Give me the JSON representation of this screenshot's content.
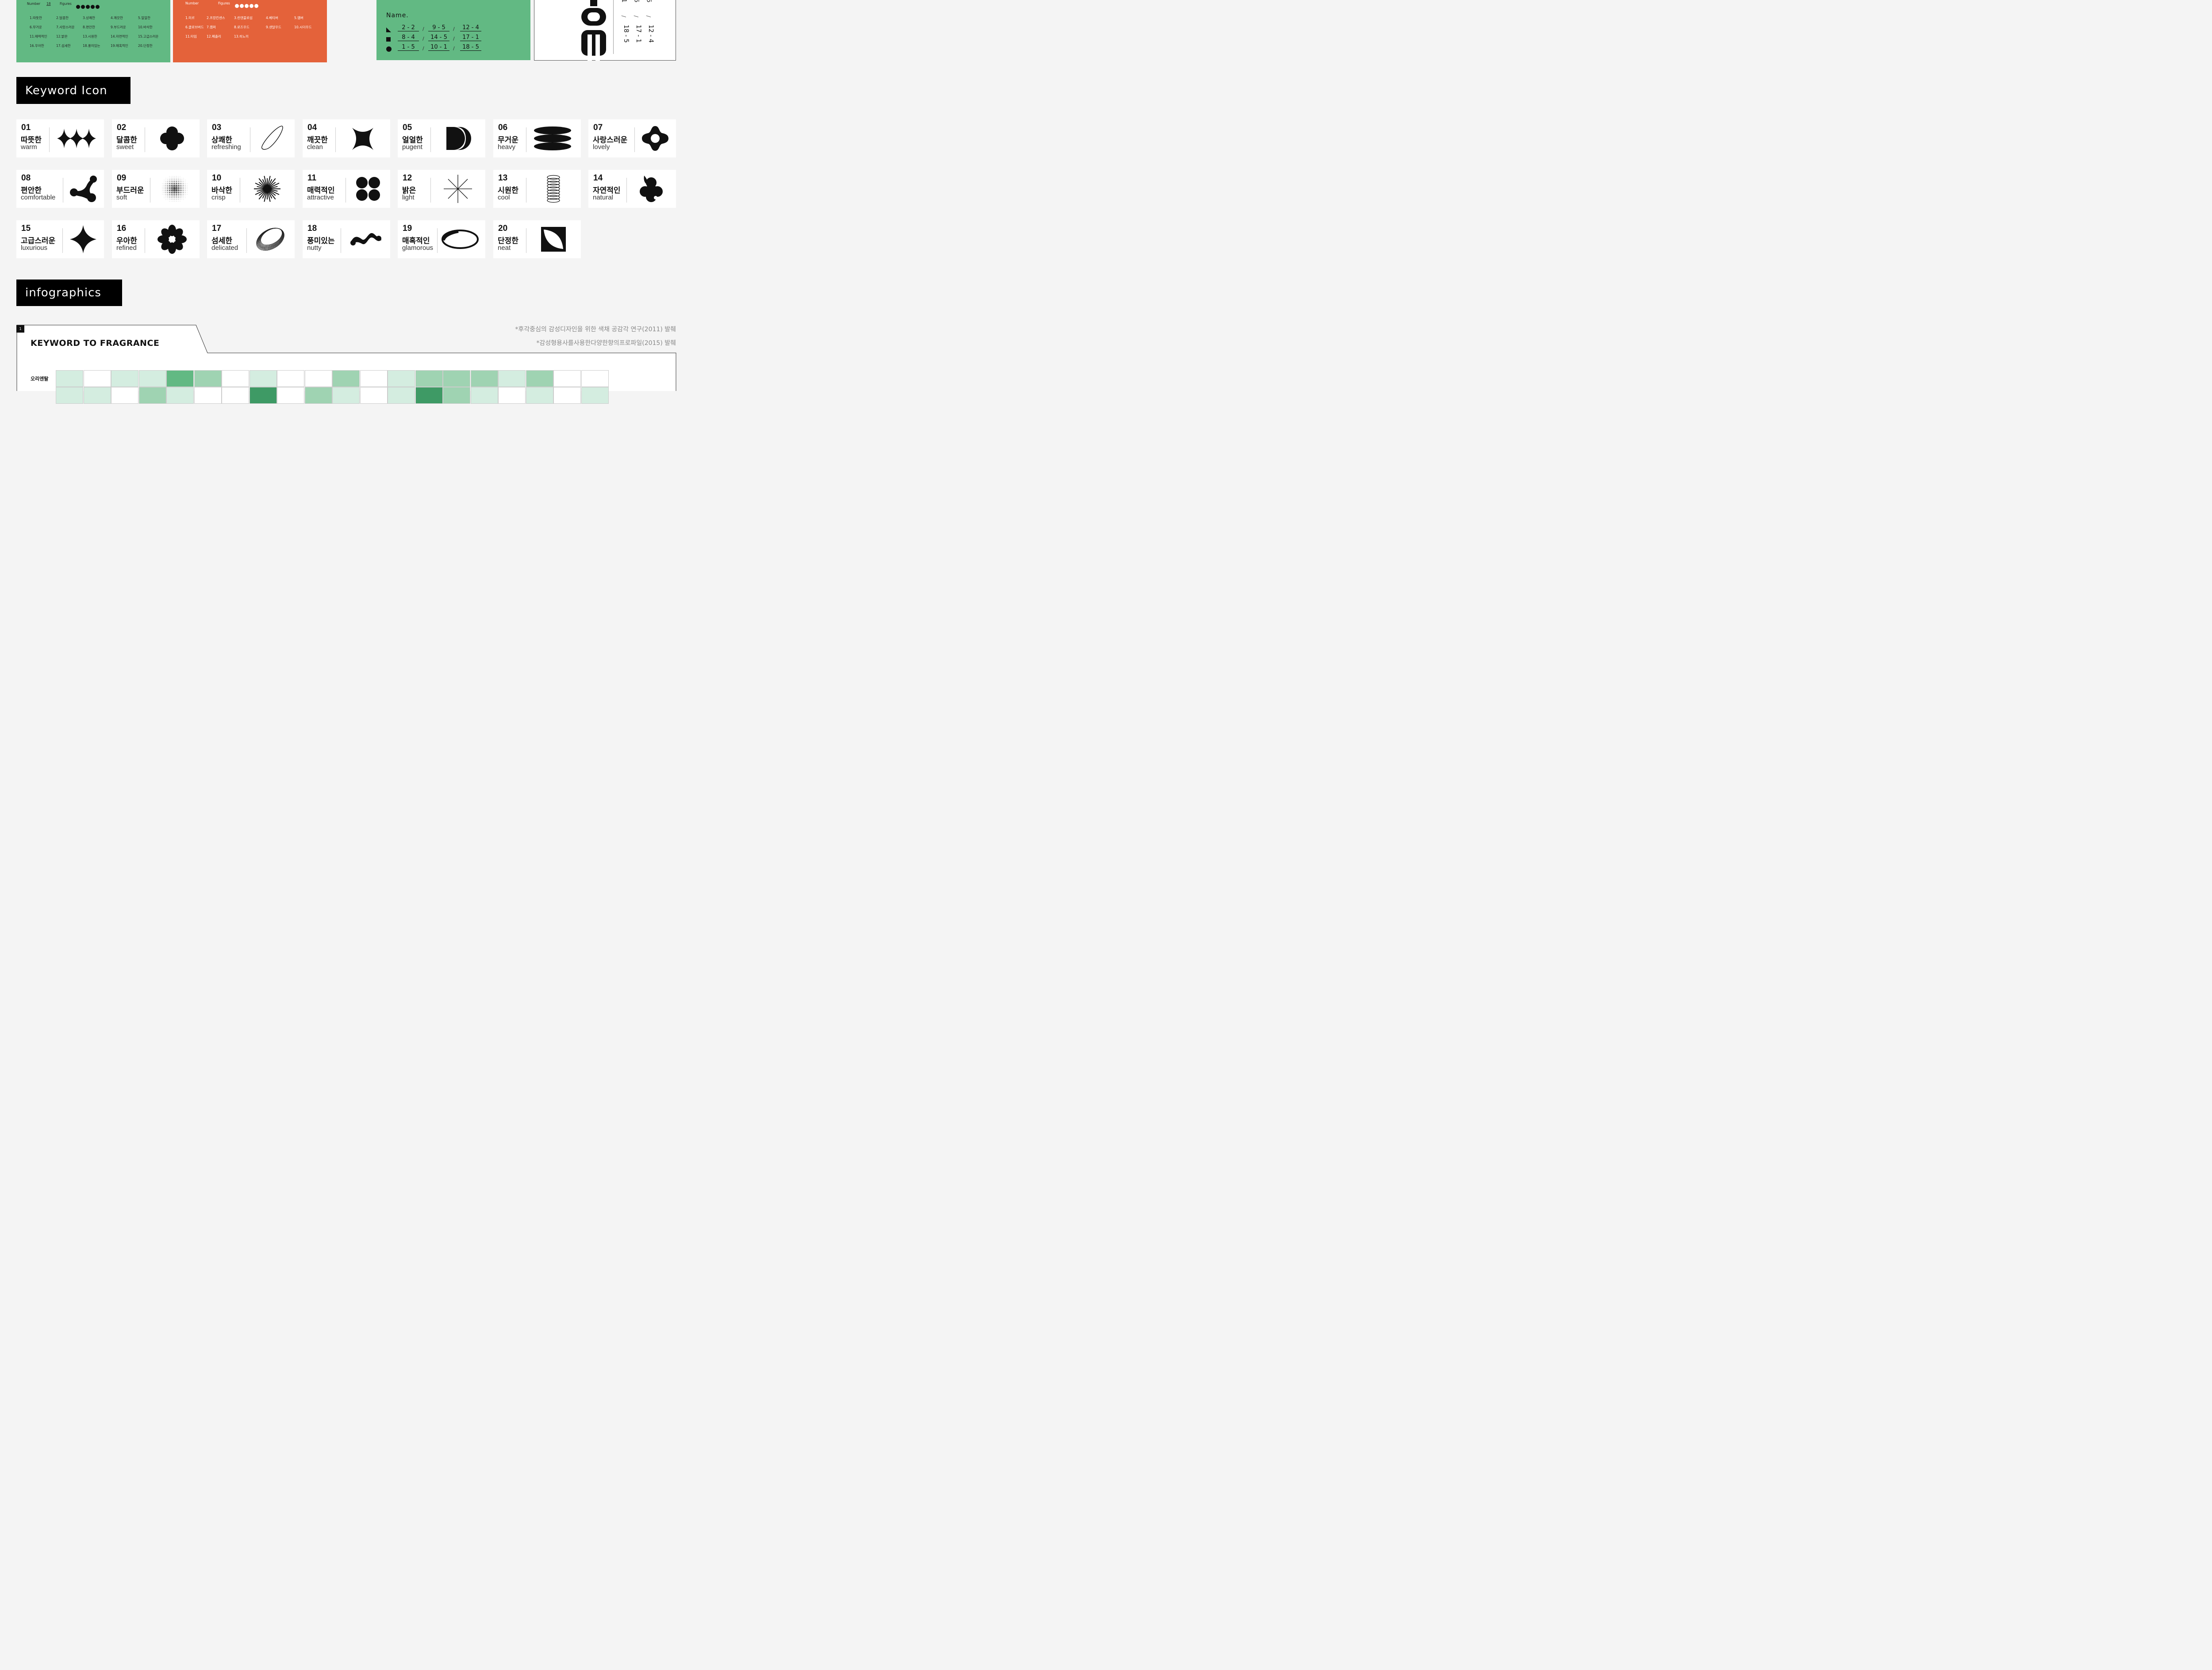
{
  "top": {
    "green_panel": {
      "number_label": "Number",
      "figures_label": "Figures",
      "number_value": "18",
      "keywords": [
        "1.따뜻한",
        "2.달콤한",
        "3.상쾌한",
        "4.깨끗한",
        "5.얼얼한",
        "6.무거운",
        "7.사랑스러운",
        "8.편안한",
        "9.부드러운",
        "10.바삭한",
        "11.매력적인",
        "12.밝은",
        "13.시원한",
        "14.자연적인",
        "15.고급스러운",
        "16.우아한",
        "17.섬세한",
        "18.풍미있는",
        "19.매혹적인",
        "20.단정한"
      ]
    },
    "orange_panel": {
      "number_label": "Number",
      "figures_label": "Figures",
      "fragrances": [
        "1.미르",
        "2.프랑킨센스",
        "3.린덴블로섬",
        "4.베티버",
        "5.앰버",
        "6.클로브버드",
        "7.캠퍼",
        "8.로즈우드",
        "9.샌달우드",
        "10.시더우드",
        "11.타임",
        "12.페출리",
        "13.히노끼"
      ]
    },
    "name_panel": {
      "title": "Name.",
      "rows": [
        {
          "shape": "triangle",
          "values": [
            "2 - 2",
            "9 - 5",
            "12 - 4"
          ]
        },
        {
          "shape": "square",
          "values": [
            "8 - 4",
            "14 - 5",
            "17 - 1"
          ]
        },
        {
          "shape": "circle",
          "values": [
            "1 - 5",
            "10 - 1",
            "18 - 5"
          ]
        }
      ],
      "separator": "/"
    },
    "white_panel": {
      "vertical_values": [
        "18 - 5",
        "17 - 1",
        "12 - 4"
      ],
      "top_values": [
        "1",
        "5",
        "5"
      ],
      "separator": "/"
    }
  },
  "keyword_icon": {
    "title": "Keyword Icon",
    "items": [
      {
        "num": "01",
        "ko": "따뜻한",
        "en": "warm",
        "icon": "sparkles-icon"
      },
      {
        "num": "02",
        "ko": "달콤한",
        "en": "sweet",
        "icon": "clover-blob-icon"
      },
      {
        "num": "03",
        "ko": "상쾌한",
        "en": "refreshing",
        "icon": "orbit-line-icon"
      },
      {
        "num": "04",
        "ko": "깨끗한",
        "en": "clean",
        "icon": "x-star-icon"
      },
      {
        "num": "05",
        "ko": "얼얼한",
        "en": "pugent",
        "icon": "double-half-circle-icon"
      },
      {
        "num": "06",
        "ko": "무거운",
        "en": "heavy",
        "icon": "stacked-discs-icon"
      },
      {
        "num": "07",
        "ko": "사랑스러운",
        "en": "lovely",
        "icon": "ring-knot-icon"
      },
      {
        "num": "08",
        "ko": "편안한",
        "en": "comfortable",
        "icon": "molecule-icon"
      },
      {
        "num": "09",
        "ko": "부드러운",
        "en": "soft",
        "icon": "halftone-circle-icon"
      },
      {
        "num": "10",
        "ko": "바삭한",
        "en": "crisp",
        "icon": "starburst-icon"
      },
      {
        "num": "11",
        "ko": "매력적인",
        "en": "attractive",
        "icon": "four-circles-icon"
      },
      {
        "num": "12",
        "ko": "밝은",
        "en": "light",
        "icon": "asterisk-lines-icon"
      },
      {
        "num": "13",
        "ko": "시원한",
        "en": "cool",
        "icon": "coil-icon"
      },
      {
        "num": "14",
        "ko": "자연적인",
        "en": "natural",
        "icon": "leaf-flower-icon"
      },
      {
        "num": "15",
        "ko": "고급스러운",
        "en": "luxurious",
        "icon": "four-point-star-icon"
      },
      {
        "num": "16",
        "ko": "우아한",
        "en": "refined",
        "icon": "flower-icon"
      },
      {
        "num": "17",
        "ko": "섬세한",
        "en": "delicated",
        "icon": "wire-ring-icon"
      },
      {
        "num": "18",
        "ko": "풍미있는",
        "en": "nutty",
        "icon": "wave-icon"
      },
      {
        "num": "19",
        "ko": "매혹적인",
        "en": "glamorous",
        "icon": "ellipse-ring-icon"
      },
      {
        "num": "20",
        "ko": "단정한",
        "en": "neat",
        "icon": "square-leaf-icon"
      }
    ]
  },
  "infographics": {
    "title": "infographics",
    "tab_number": "1",
    "chart_title": "KEYWORD TO FRAGRANCE",
    "notes": [
      "*후각중심의 감성디자인을 위한 색채 공감각 연구(2011) 발췌",
      "*감성형용사를사용한다양한향의프로파일(2015) 발췌"
    ],
    "row_label": "오리엔탈",
    "row_levels": [
      1,
      0,
      1,
      1,
      3,
      2,
      0,
      1,
      0,
      0,
      2,
      0,
      1,
      2,
      2,
      2,
      1,
      2,
      0,
      0
    ],
    "colors": {
      "level0": "#ffffff",
      "level1": "#d4ede0",
      "level2": "#9fd3b2",
      "level3": "#62b983"
    }
  },
  "colors": {
    "green": "#62b983",
    "orange": "#e4623a",
    "black": "#000000"
  }
}
